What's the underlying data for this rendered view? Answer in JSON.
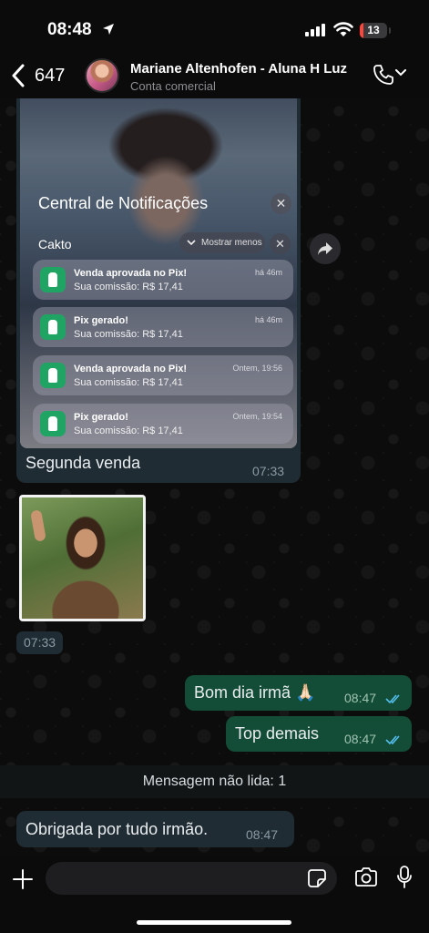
{
  "status_bar": {
    "time": "08:48",
    "battery": "13",
    "battery_level_percent": 13
  },
  "header": {
    "back_count": "647",
    "contact_name": "Mariane Altenhofen - Aluna H Luz",
    "contact_subtitle": "Conta comercial"
  },
  "messages": {
    "notification_card": {
      "title": "Central de Notificações",
      "app": "Cakto",
      "show_less": "Mostrar menos",
      "items": [
        {
          "title": "Venda aprovada no Pix!",
          "sub": "Sua comissão: R$ 17,41",
          "time": "há 46m"
        },
        {
          "title": "Pix gerado!",
          "sub": "Sua comissão: R$ 17,41",
          "time": "há 46m"
        },
        {
          "title": "Venda aprovada no Pix!",
          "sub": "Sua comissão: R$ 17,41",
          "time": "Ontem, 19:56"
        },
        {
          "title": "Pix gerado!",
          "sub": "Sua comissão: R$ 17,41",
          "time": "Ontem, 19:54"
        }
      ]
    },
    "image_caption": "Segunda venda",
    "image_caption_time": "07:33",
    "photo_time": "07:33",
    "outgoing": [
      {
        "text": "Bom dia irmã 🙏🏻",
        "time": "08:47"
      },
      {
        "text": "Top demais",
        "time": "08:47"
      }
    ],
    "unread_banner": "Mensagem não lida: 1",
    "incoming_last": {
      "text": "Obrigada por tudo irmão.",
      "time": "08:47"
    }
  },
  "composer": {
    "placeholder": ""
  },
  "colors": {
    "outgoing_bubble": "#144d37",
    "incoming_bubble": "#1f2c33",
    "read_ticks": "#53bdeb"
  }
}
